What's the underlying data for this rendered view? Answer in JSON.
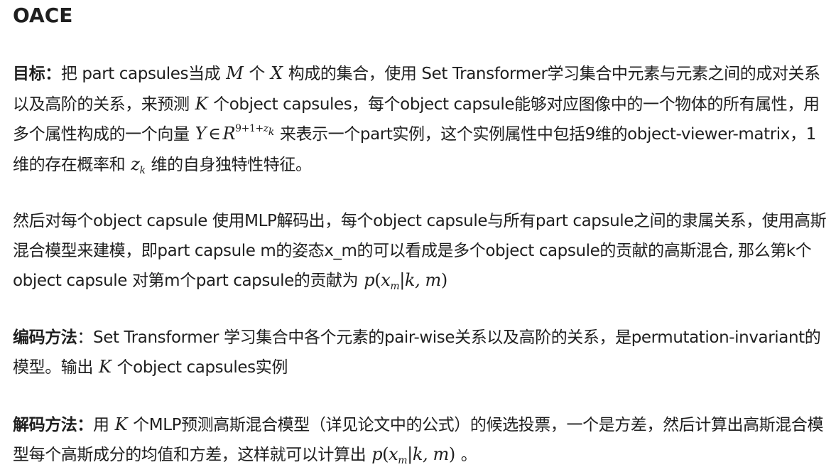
{
  "title": "OACE",
  "p1": {
    "label": "目标：",
    "t1": "把 part capsules当成",
    "m_M": "M",
    "t2": "个",
    "m_X": "X",
    "t3": "构成的集合，使用 Set Transformer学习集合中元素与元素之间的成对关系以及高阶的关系，来预测",
    "m_K": "K",
    "t4": "个object capsules，每个object capsule能够对应图像中的一个物体的所有属性，用多个属性构成的一个向量",
    "m_Y": "Y",
    "m_in": "∈",
    "m_R": "R",
    "m_sup": "9+1+",
    "m_sup_z": "z",
    "m_sup_k": "k",
    "t5": "来表示一个part实例，这个实例属性中包括9维的object-viewer-matrix，1维的存在概率和",
    "m_z": "z",
    "m_zk": "k",
    "t6": "维的自身独特性特征。"
  },
  "p2": {
    "t1": "然后对每个object capsule 使用MLP解码出，每个object capsule与所有part capsule之间的隶属关系，使用高斯混合模型来建模，即part capsule m的姿态x_m的可以看成是多个object capsule的贡献的高斯混合, 那么第k个object capsule 对第m个part capsule的贡献为",
    "f_p": "p",
    "f_open": "(",
    "f_x": "x",
    "f_m_sub": "m",
    "f_rest": "|k, m",
    "f_close": ")"
  },
  "p3": {
    "label": "编码方法",
    "t1": "：Set Transformer 学习集合中各个元素的pair-wise关系以及高阶的关系，是permutation-invariant的模型。输出",
    "m_K": "K",
    "t2": "个object capsules实例"
  },
  "p4": {
    "label": "解码方法：",
    "t1": "用",
    "m_K": "K",
    "t2": "个MLP预测高斯混合模型（详见论文中的公式）的候选投票，一个是方差，然后计算出高斯混合模型每个高斯成分的均值和方差，这样就可以计算出",
    "f_p": "p",
    "f_open": "(",
    "f_x": "x",
    "f_m_sub": "m",
    "f_rest": "|k, m",
    "f_close": ")",
    "t3": "。"
  }
}
